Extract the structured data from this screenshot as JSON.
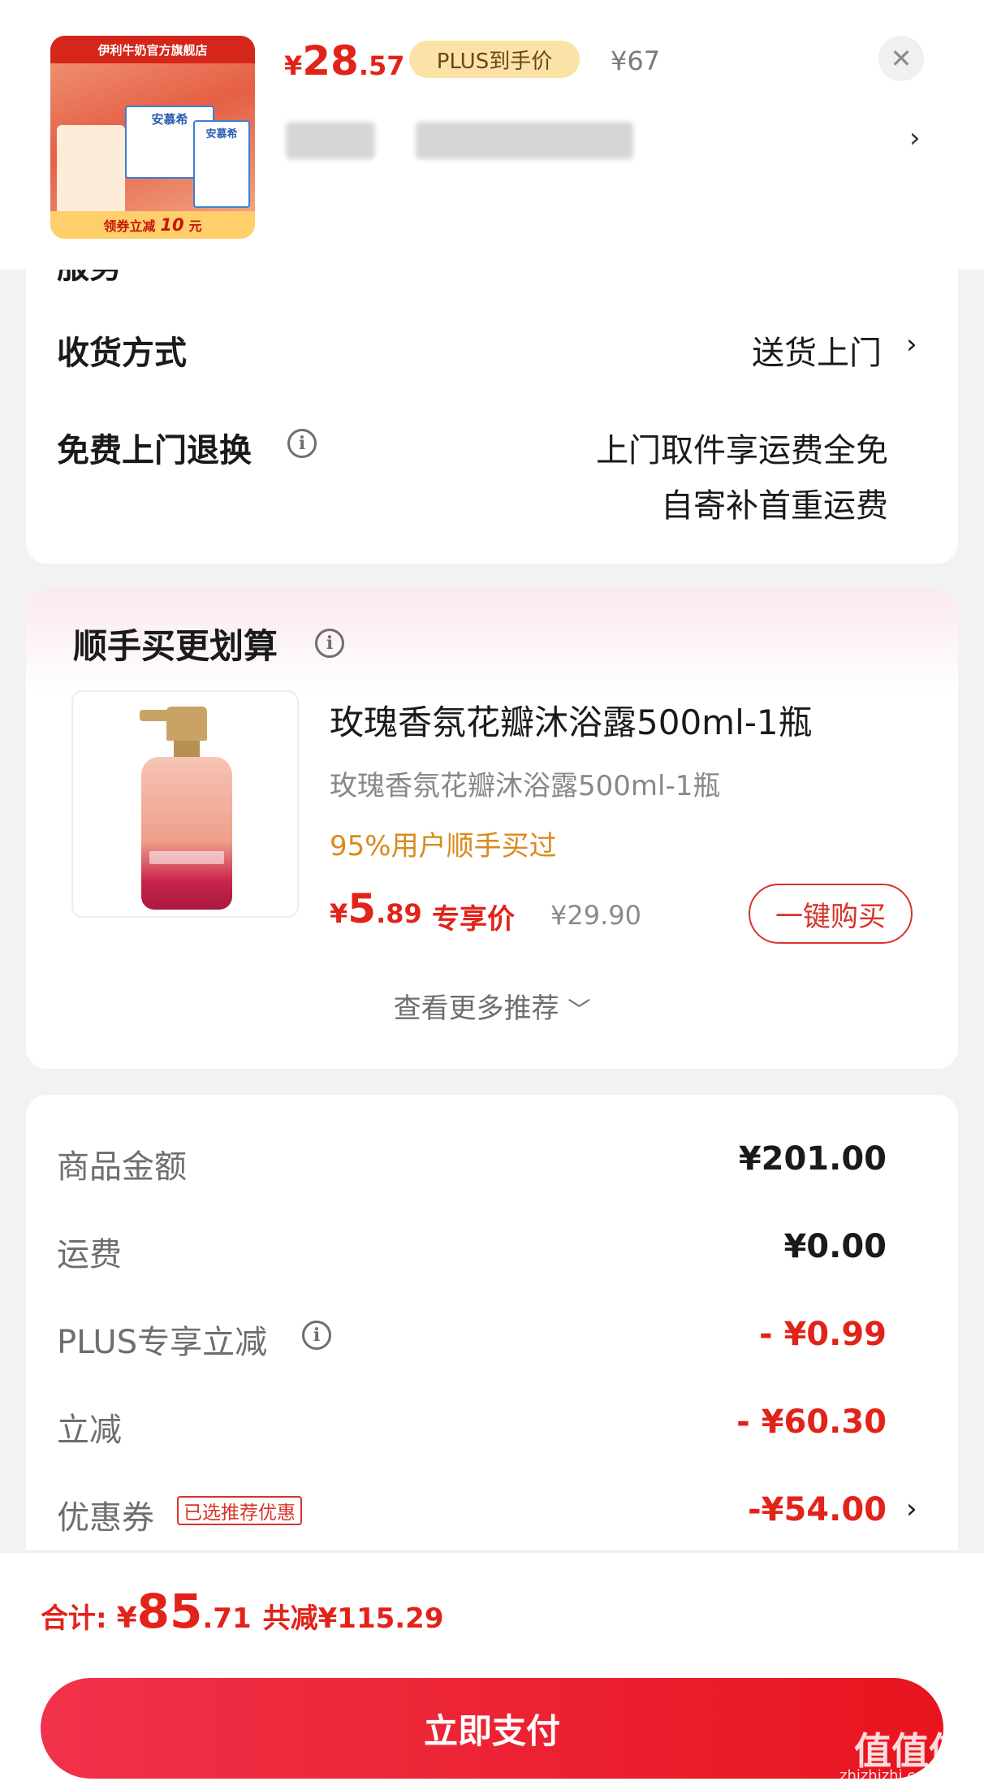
{
  "header": {
    "thumbnail": {
      "store_name": "伊利牛奶官方旗舰店",
      "brand_a": "安慕希",
      "brand_b": "安慕希",
      "footer_prefix": "领券立减",
      "footer_amount": "10",
      "footer_suffix": "元"
    },
    "price": {
      "currency": "¥",
      "integer": "28",
      "decimal": ".57"
    },
    "plus_tag": "PLUS到手价",
    "original_price": "¥67",
    "close_icon": "close-icon",
    "chevron": "›"
  },
  "delivery": {
    "service_label": "服务",
    "shipping_method": {
      "label": "收货方式",
      "value": "送货上门"
    },
    "free_return": {
      "label": "免费上门退换",
      "value_line1": "上门取件享运费全免",
      "value_line2": "自寄补首重运费"
    }
  },
  "recommend": {
    "title": "顺手买更划算",
    "product": {
      "name": "玫瑰香氛花瓣沐浴露500ml-1瓶",
      "subtitle": "玫瑰香氛花瓣沐浴露500ml-1瓶",
      "stat": "95%用户顺手买过",
      "price": {
        "currency": "¥",
        "integer": "5",
        "decimal": ".89"
      },
      "price_tag": "专享价",
      "original_price": "¥29.90",
      "buy_label": "一键购买"
    },
    "more_label": "查看更多推荐"
  },
  "summary": {
    "items": [
      {
        "label": "商品金额",
        "value": "¥201.00"
      },
      {
        "label": "运费",
        "value": "¥0.00"
      },
      {
        "label": "PLUS专享立减",
        "value": "- ¥0.99"
      },
      {
        "label": "立减",
        "value": "- ¥60.30"
      },
      {
        "label": "优惠券",
        "value": "-¥54.00"
      }
    ],
    "coupon_badge": "已选推荐优惠"
  },
  "footer": {
    "total_label": "合计:",
    "total": {
      "currency": "¥",
      "integer": "85",
      "decimal": ".71"
    },
    "saved": "共减¥115.29",
    "pay_label": "立即支付",
    "watermark": "值值值",
    "watermark_url": "zhizhizhi.com"
  },
  "colors": {
    "accent_red": "#e2231a",
    "plus_gold": "#fbe3a7",
    "stat_orange": "#d98a1e"
  }
}
